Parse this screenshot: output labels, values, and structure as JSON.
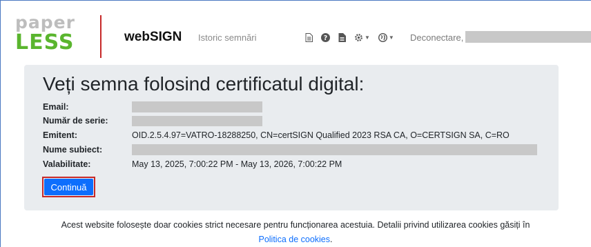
{
  "header": {
    "logo_top": "paper",
    "logo_bottom": "LESS",
    "brand": "webSIGN",
    "history_link": "Istoric semnări",
    "icons": [
      "document-icon",
      "help-icon",
      "file-icon",
      "settings-icon",
      "globe-icon"
    ],
    "logout_label": "Deconectare,",
    "accent_color": "#5ab52e",
    "divider_color": "#c62828"
  },
  "panel": {
    "title": "Veți semna folosind certificatul digital:",
    "rows": [
      {
        "label": "Email:",
        "value": ""
      },
      {
        "label": "Număr de serie:",
        "value": ""
      },
      {
        "label": "Emitent:",
        "value": "OID.2.5.4.97=VATRO-18288250, CN=certSIGN Qualified 2023 RSA CA, O=CERTSIGN SA, C=RO"
      },
      {
        "label": "Nume subiect:",
        "value": ""
      },
      {
        "label": "Valabilitate:",
        "value": "May 13, 2025, 7:00:22 PM - May 13, 2026, 7:00:22 PM"
      }
    ],
    "continue_label": "Continuă",
    "button_color": "#0d6efd"
  },
  "footer": {
    "text": "Acest website folosește doar cookies strict necesare pentru funcționarea acestuia. Detalii privind utilizarea cookies găsiți în",
    "link_label": "Politica de cookies",
    "link_suffix": "."
  }
}
